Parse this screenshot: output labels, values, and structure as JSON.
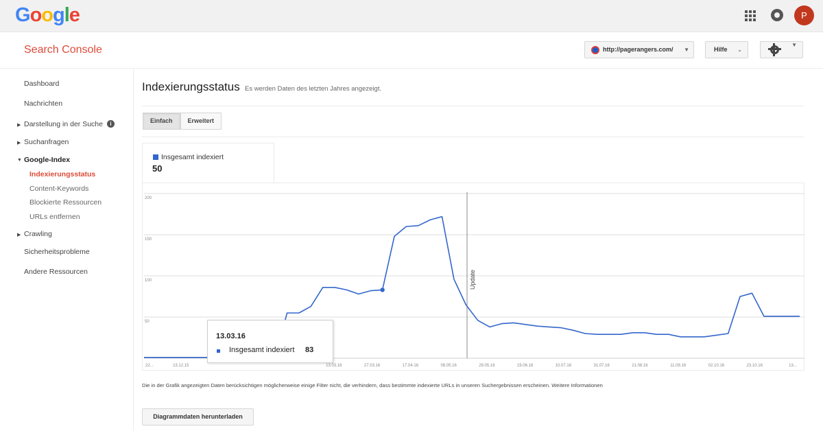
{
  "google_bar": {
    "logo": [
      "G",
      "o",
      "o",
      "g",
      "l",
      "e"
    ],
    "logo_colors": [
      "#4285f4",
      "#ea4335",
      "#fbbc05",
      "#4285f4",
      "#34a853",
      "#ea4335"
    ],
    "avatar_initial": "P",
    "icons": [
      "apps-icon",
      "notifications-icon"
    ]
  },
  "header": {
    "title": "Search Console",
    "site": "http://pagerangers.com/",
    "help": "Hilfe",
    "settings_icon": "gear-icon"
  },
  "sidebar": {
    "dashboard": "Dashboard",
    "messages": "Nachrichten",
    "search_appearance": "Darstellung in der Suche",
    "search_traffic": "Suchanfragen",
    "google_index": "Google-Index",
    "index_status": "Indexierungsstatus",
    "content_keywords": "Content-Keywords",
    "blocked_resources": "Blockierte Ressourcen",
    "remove_urls": "URLs entfernen",
    "crawling": "Crawling",
    "security_issues": "Sicherheitsprobleme",
    "other_resources": "Andere Ressourcen"
  },
  "main": {
    "title": "Indexierungsstatus",
    "subtitle": "Es werden Daten des letzten Jahres angezeigt.",
    "tabs": [
      "Einfach",
      "Erweitert"
    ],
    "legend_label": "Insgesamt indexiert",
    "legend_value": "50",
    "footnote": "Die in der Grafik angezeigten Daten berücksichtigen möglicherweise einige Filter nicht, die verhindern, dass bestimmte indexierte URLs in unseren Suchergebnissen erscheinen. Weitere Informationen",
    "download": "Diagrammdaten herunterladen"
  },
  "tooltip": {
    "date": "13.03.16",
    "label": "Insgesamt indexiert",
    "value": "83"
  },
  "chart_data": {
    "type": "line",
    "series": [
      {
        "name": "Insgesamt indexiert",
        "color": "#3366cc",
        "values": [
          1,
          1,
          1,
          1,
          1,
          1,
          1,
          1,
          1,
          1,
          1,
          1,
          55,
          55,
          63,
          86,
          86,
          83,
          78,
          82,
          83,
          148,
          160,
          161,
          168,
          172,
          96,
          65,
          46,
          38,
          42,
          43,
          41,
          39,
          38,
          37,
          34,
          30,
          29,
          29,
          29,
          31,
          31,
          29,
          29,
          26,
          26,
          26,
          28,
          30,
          75,
          79,
          51,
          51,
          51,
          51
        ]
      }
    ],
    "x_tick_labels": [
      "22...",
      "13.12.15",
      "",
      "",
      "",
      "13.03.16",
      "27.03.16",
      "17.04.16",
      "08.05.16",
      "29.05.16",
      "19.06.16",
      "10.07.16",
      "31.07.16",
      "21.08.16",
      "11.09.16",
      "02.10.16",
      "23.10.16",
      "13..."
    ],
    "y_ticks": [
      50,
      100,
      150,
      200
    ],
    "ylim": [
      0,
      200
    ],
    "annotation": "Update",
    "highlight_index": 20
  }
}
